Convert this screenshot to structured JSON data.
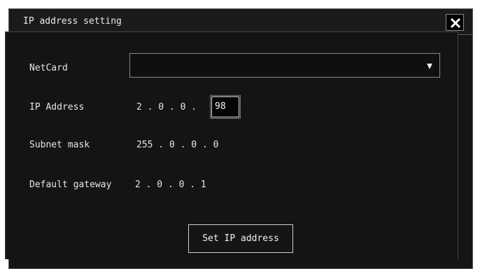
{
  "dialog": {
    "title": "IP address setting",
    "close_icon": "close-icon"
  },
  "fields": {
    "netcard": {
      "label": "NetCard",
      "value": "",
      "dropdown_icon": "chevron-down-icon"
    },
    "ip_address": {
      "label": "IP Address",
      "prefix": "2 . 0 . 0 .",
      "last_octet": "98"
    },
    "subnet_mask": {
      "label": "Subnet mask",
      "value": "255 . 0 . 0 . 0"
    },
    "default_gateway": {
      "label": "Default gateway",
      "value": "2 . 0 . 0 . 1"
    }
  },
  "actions": {
    "set_ip_label": "Set IP address"
  },
  "colors": {
    "background": "#151515",
    "text": "#e6e6e6",
    "border": "#8b8b8b"
  }
}
